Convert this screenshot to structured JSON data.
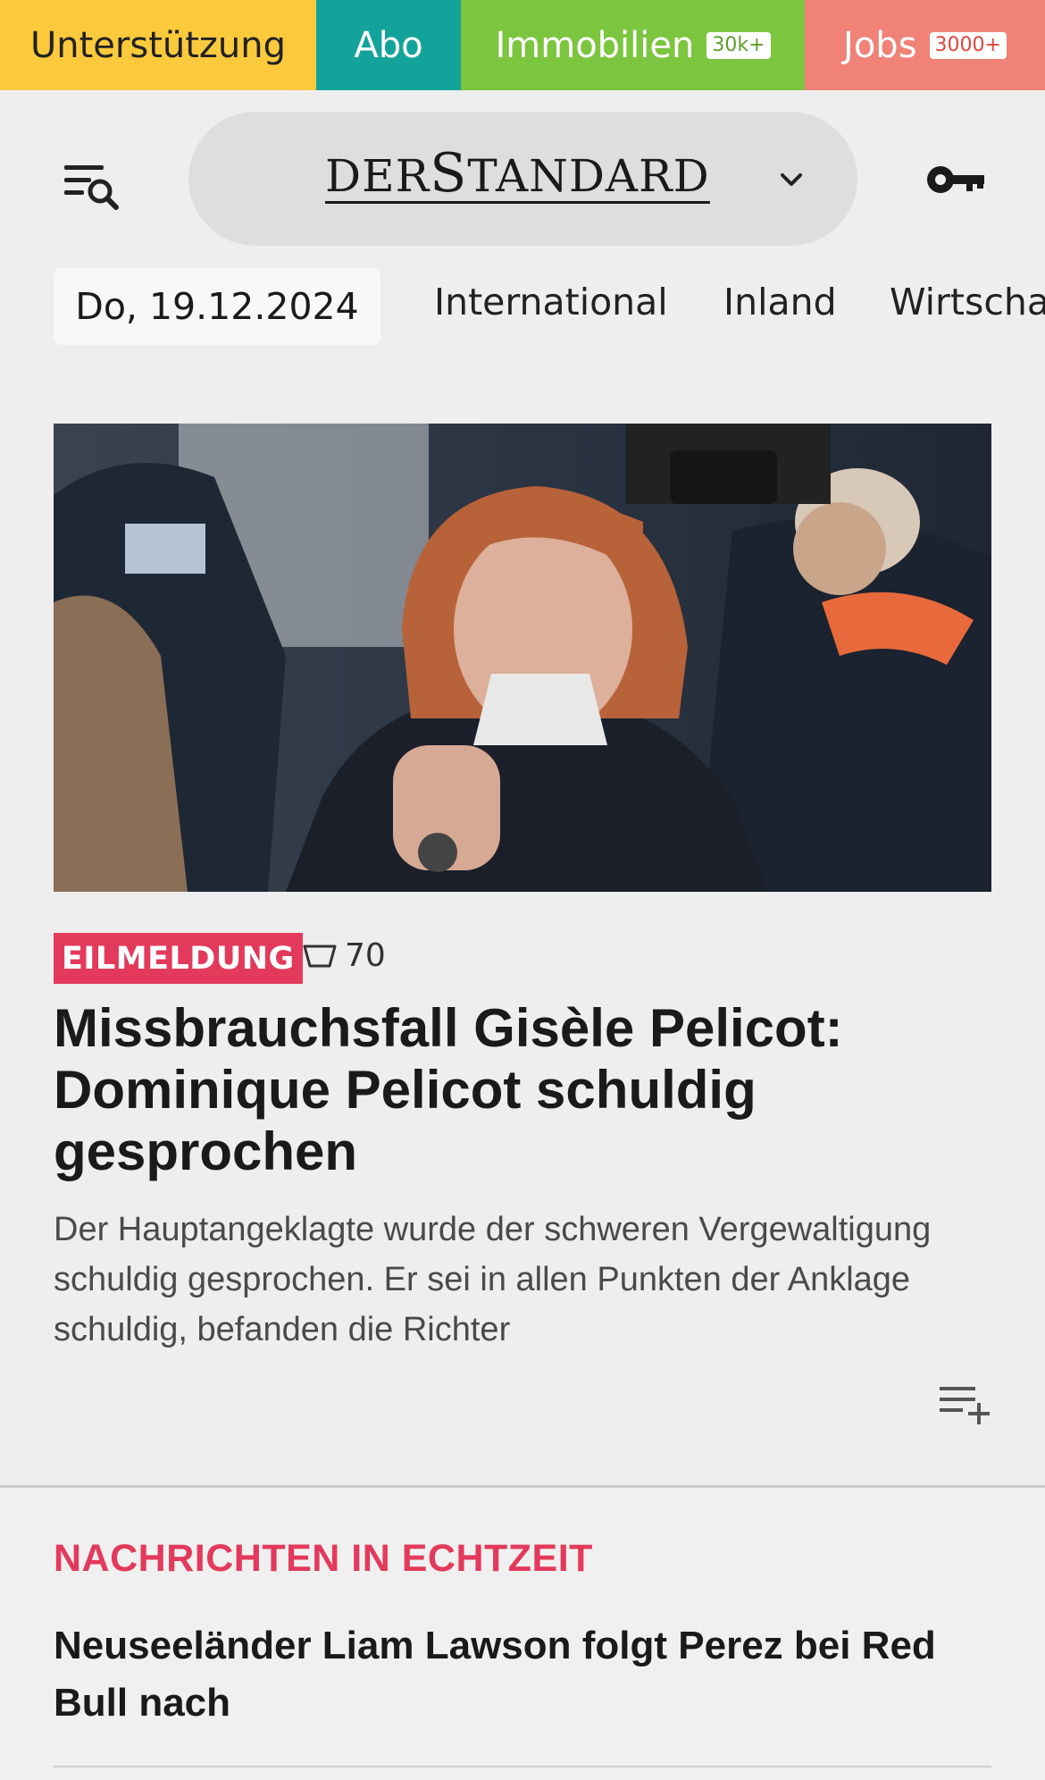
{
  "topbar": {
    "support_label": "Unterstützung",
    "abo_label": "Abo",
    "immo_label": "Immobilien",
    "immo_badge": "30k+",
    "jobs_label": "Jobs",
    "jobs_badge": "3000+"
  },
  "header": {
    "logo_der": "DER",
    "logo_s": "S",
    "logo_tandard": "TANDARD",
    "menu_icon": "menu-search-icon",
    "dropdown_icon": "chevron-down-icon",
    "login_icon": "key-icon"
  },
  "nav": {
    "date": "Do, 19.12.2024",
    "items": [
      "International",
      "Inland",
      "Wirtscha"
    ]
  },
  "article": {
    "badge": "EILMELDUNG",
    "comment_count": "70",
    "headline": "Missbrauchsfall Gisèle Pelicot: Dominique Pelicot schuldig gesprochen",
    "teaser": "Der Hauptangeklagte wurde der schweren Vergewaltigung schuldig gesprochen. Er sei in allen Punkten der Anklage schuldig, befanden die Richter",
    "playlist_icon": "playlist-add-icon"
  },
  "live": {
    "section_title": "NACHRICHTEN IN ECHTZEIT",
    "items": [
      "Neuseeländer Liam Lawson folgt Perez bei Red Bull nach"
    ]
  },
  "colors": {
    "support": "#fbc93c",
    "abo": "#14a39a",
    "immo": "#7cc53f",
    "jobs": "#f08278",
    "accent": "#e33a5c"
  }
}
